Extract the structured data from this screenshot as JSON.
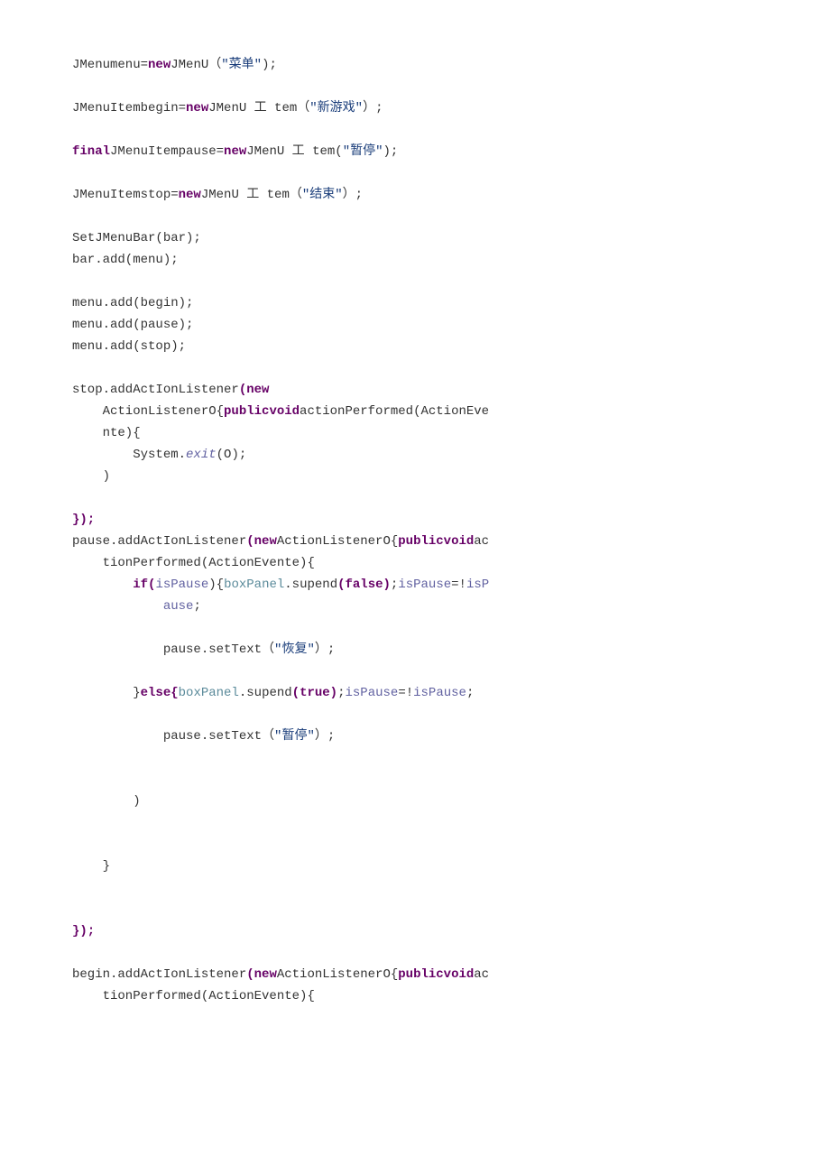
{
  "code": {
    "l01_a": "JMenumenu=",
    "l01_new": "new",
    "l01_b": "JMenU（",
    "l01_str": "\"菜单\"",
    "l01_c": ");",
    "l02_a": "JMenuItembegin=",
    "l02_new": "new",
    "l02_b": "JMenU 工 tem（",
    "l02_str": "\"新游戏\"",
    "l02_c": "）;",
    "l03_final": "final",
    "l03_a": "JMenuItempause=",
    "l03_new": "new",
    "l03_b": "JMenU 工 tem(",
    "l03_str": "\"暂停\"",
    "l03_c": ");",
    "l04_a": "JMenuItemstop=",
    "l04_new": "new",
    "l04_b": "JMenU 工 tem（",
    "l04_str": "\"结束\"",
    "l04_c": "）;",
    "l05": "SetJMenuBar(bar);",
    "l06": "bar.add(menu);",
    "l07": "menu.add(begin);",
    "l08": "menu.add(pause);",
    "l09": "menu.add(stop);",
    "l10_a": "stop.addActIonListener",
    "l10_new": "(new",
    "l11_a": "    ActionListenerO{",
    "l11_pv": "publicvoid",
    "l11_b": "actionPerformed(ActionEve",
    "l12": "    nte){",
    "l13_a": "        System.",
    "l13_exit": "exit",
    "l13_b": "(O);",
    "l14": "    )",
    "l15": "});",
    "l16_a": "pause.addActIonListener",
    "l16_new": "(new",
    "l16_b": "ActionListenerO{",
    "l16_pv": "publicvoid",
    "l16_c": "ac",
    "l17": "    tionPerformed(ActionEvente){",
    "l18_if": "if(",
    "l18_isp": "isPause",
    "l18_b": "){",
    "l18_bp": "boxPanel",
    "l18_c": ".supend",
    "l18_false": "(false)",
    "l18_d": ";",
    "l18_isp2": "isPause",
    "l18_e": "=!",
    "l18_isp3": "isP",
    "l19_ause": "ause",
    "l19_sc": ";",
    "l20_a": "            pause.setText（",
    "l20_str": "\"恢复\"",
    "l20_b": "）;",
    "l21_a": "        }",
    "l21_else": "else{",
    "l21_bp": "boxPanel",
    "l21_b": ".supend",
    "l21_true": "(true)",
    "l21_c": ";",
    "l21_isp": "isPause",
    "l21_d": "=!",
    "l21_isp2": "isPause",
    "l21_e": ";",
    "l22_a": "            pause.setText（",
    "l22_str": "\"暂停\"",
    "l22_b": "）;",
    "l23": "        )",
    "l24": "    }",
    "l25": "});",
    "l26_a": "begin.addActIonListener",
    "l26_new": "(new",
    "l26_b": "ActionListenerO{",
    "l26_pv": "publicvoid",
    "l26_c": "ac",
    "l27": "    tionPerformed(ActionEvente){"
  }
}
